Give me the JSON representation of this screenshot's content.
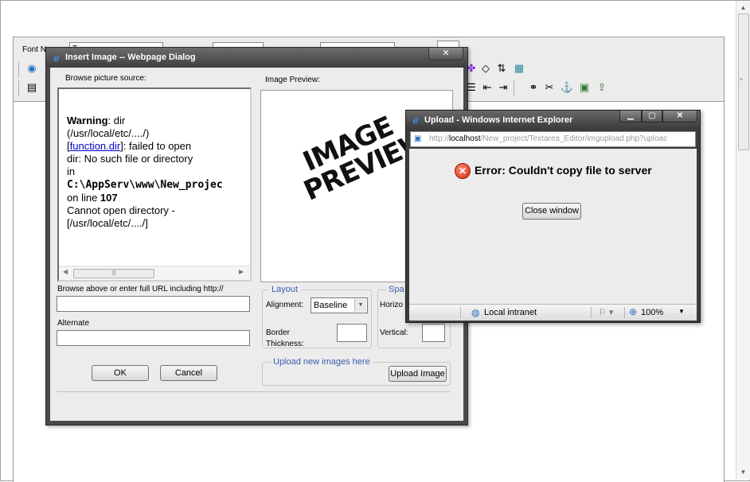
{
  "editor": {
    "toolbar": {
      "font_name_label": "Font N",
      "font_name_value": "T"
    }
  },
  "insert_dialog": {
    "title": "Insert Image -- Webpage Dialog",
    "close_glyph": "✕",
    "browse_label": "Browse picture source:",
    "preview_label": "Image Preview:",
    "warning": {
      "bold_lead": "Warning",
      "line1_rest": ": dir",
      "line2": "(/usr/local/etc/..../)",
      "link_text": "function.dir",
      "line3_rest": "]: failed to open",
      "line4": "dir: No such file or directory",
      "line5": "in",
      "path": "C:\\AppServ\\www\\New_projec",
      "line7_pre": "on line ",
      "line_number": "107",
      "line8": "Cannot open directory -",
      "line9": "[/usr/local/etc/..../]"
    },
    "preview_image_text_1": "IMAGE",
    "preview_image_text_2": "PREVIEW",
    "url_label": "Browse above or enter full URL including http://",
    "url_value": "",
    "alternate_label": "Alternate",
    "alternate_value": "",
    "layout_legend": "Layout",
    "alignment_label": "Alignment:",
    "alignment_value": "Baseline",
    "border_label_1": "Border",
    "border_label_2": "Thickness:",
    "spacing_legend": "Spa",
    "horizontal_label": "Horizo",
    "vertical_label": "Vertical:",
    "upload_legend": "Upload new images here",
    "upload_button": "Upload Image",
    "ok_button": "OK",
    "cancel_button": "Cancel"
  },
  "upload_window": {
    "title": "Upload - Windows Internet Explorer",
    "address_prefix": "http://",
    "address_host": "localhost",
    "address_rest": "/New_project/Textarea_Editor/imgupload.php?uploac",
    "error_message": "Error: Couldn't copy file to server",
    "close_button": "Close window",
    "status_zone": "Local intranet",
    "zoom": "100%"
  }
}
